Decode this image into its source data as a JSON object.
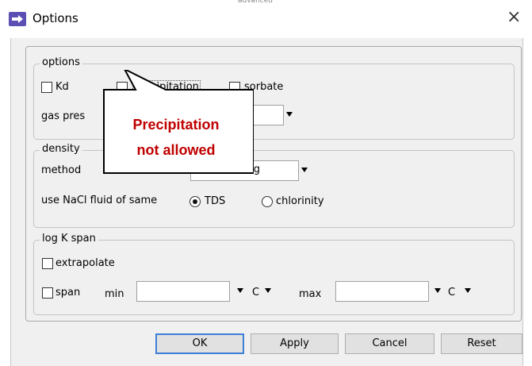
{
  "window": {
    "title": "Options",
    "close_glyph": "×",
    "top_cut_text": "advanced"
  },
  "options": {
    "legend": "options",
    "kd_label": "Kd",
    "precipitation_label": "precipitation",
    "sorbate_label": "sorbate",
    "gas_label": "gas pres",
    "gas_value": ""
  },
  "density": {
    "legend": "density",
    "method_label": "method",
    "method_value": "Batzle-Wang",
    "nacl_label": "use NaCl fluid of same",
    "tds_label": "TDS",
    "chlorinity_label": "chlorinity",
    "selected": "TDS"
  },
  "logk": {
    "legend": "log K span",
    "extrapolate_label": "extrapolate",
    "span_label": "span",
    "min_label": "min",
    "max_label": "max",
    "min_value": "",
    "max_value": "",
    "min_unit": "C",
    "max_unit": "C"
  },
  "buttons": {
    "ok": "OK",
    "apply": "Apply",
    "cancel": "Cancel",
    "reset": "Reset"
  },
  "callout": {
    "line1": "Precipitation",
    "line2": "not allowed",
    "color": "#c00000"
  },
  "icons": {
    "app": "arrow-right-icon",
    "close": "close-icon",
    "dropdown": "chevron-down-icon"
  }
}
